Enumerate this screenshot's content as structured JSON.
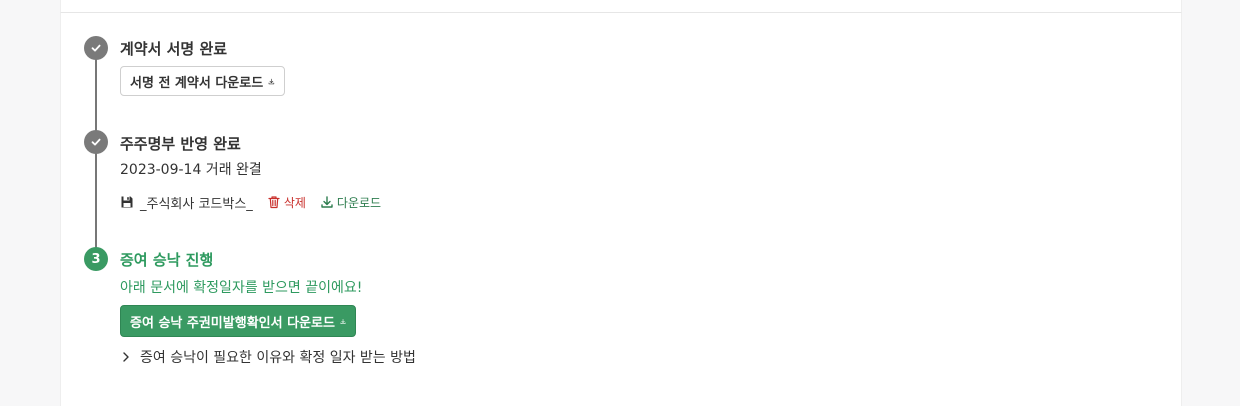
{
  "steps": [
    {
      "status": "done",
      "title": "계약서 서명 완료",
      "button_label": "서명 전 계약서 다운로드"
    },
    {
      "status": "done",
      "title": "주주명부 반영 완료",
      "date_text": "2023-09-14 거래 완결",
      "file": {
        "name": "_주식회사 코드박스_",
        "delete_label": "삭제",
        "download_label": "다운로드"
      }
    },
    {
      "status": "active",
      "number": "3",
      "title": "증여 승낙 진행",
      "subtitle": "아래 문서에 확정일자를 받으면 끝이에요!",
      "button_label": "증여 승낙 주권미발행확인서 다운로드",
      "expand_label": "증여 승낙이 필요한 이유와 확정 일자 받는 방법"
    }
  ],
  "colors": {
    "accent": "#3a9a63",
    "done": "#7a7a7a",
    "delete": "#c9302c"
  },
  "icons": [
    "check-icon",
    "download-icon",
    "save-icon",
    "trash-icon",
    "chevron-right-icon"
  ]
}
